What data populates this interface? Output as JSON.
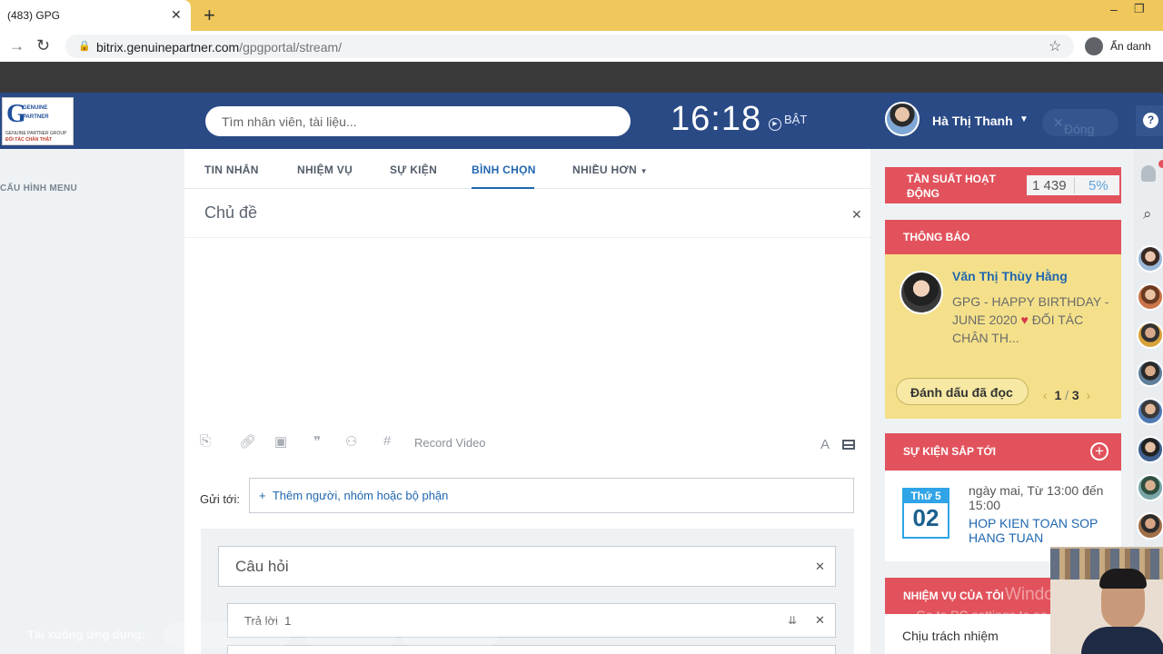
{
  "browser": {
    "tab_title": "(483) GPG",
    "url_host": "bitrix.genuinepartner.com",
    "url_path": "/gpgportal/stream/",
    "incognito_label": "Ẩn danh"
  },
  "header": {
    "logo": {
      "line1": "GENUINE",
      "line2": "PARTNER",
      "line3": "GENUINE PARTNER GROUP",
      "line4": "ĐỐI TÁC CHÂN THẬT"
    },
    "search_placeholder": "Tìm nhân viên, tài liệu...",
    "clock": "16:18",
    "clock_toggle": "BẬT",
    "user_name": "Hà Thị Thanh",
    "close_label": "Đóng"
  },
  "left_menu": {
    "config_label": "CẤU HÌNH MENU"
  },
  "feed": {
    "tabs": [
      {
        "label": "TIN NHẮN"
      },
      {
        "label": "NHIỆM VỤ"
      },
      {
        "label": "SỰ KIỆN"
      },
      {
        "label": "BÌNH CHỌN"
      },
      {
        "label": "NHIỀU HƠN"
      }
    ],
    "active_tab": "BÌNH CHỌN",
    "subject_placeholder": "Chủ đề",
    "record_video": "Record Video",
    "send_to_label": "Gửi tới:",
    "send_to_add": "Thêm người, nhóm hoặc bộ phận",
    "poll": {
      "question_placeholder": "Câu hỏi",
      "answer_placeholder": "Trả lời",
      "answer_number": "1"
    },
    "download_label": "Tải xuống ứng dụng:"
  },
  "sidebar": {
    "activity": {
      "label": "TẦN SUẤT HOẠT ĐỘNG",
      "count": "1 439",
      "percent": "5%"
    },
    "notifications": {
      "title": "THÔNG BÁO",
      "author": "Văn Thị Thùy Hằng",
      "text_part1": "GPG - HAPPY BIRTHDAY - JUNE 2020",
      "text_part2": "ĐỐI TÁC CHÂN TH...",
      "mark_read": "Đánh dấu đã đọc",
      "page_current": "1",
      "page_total": "3"
    },
    "upcoming_events": {
      "title": "SỰ KIỆN SẮP TỚI",
      "weekday": "Thứ 5",
      "day": "02",
      "time": "ngày mai, Từ 13:00 đến 15:00",
      "event_title": "HOP KIEN TOAN SOP HANG TUAN"
    },
    "my_tasks": {
      "title": "NHIỆM VỤ CỦA TÔI",
      "responsible": "Chịu trách nhiệm"
    },
    "watermark_line1": "Windows",
    "watermark_line2": "Go to PC settings to ac"
  },
  "colors": {
    "header_blue": "#2a4a86",
    "accent_red": "#e2525c",
    "notice_yellow": "#f4e08a",
    "link_blue": "#2067b0"
  }
}
